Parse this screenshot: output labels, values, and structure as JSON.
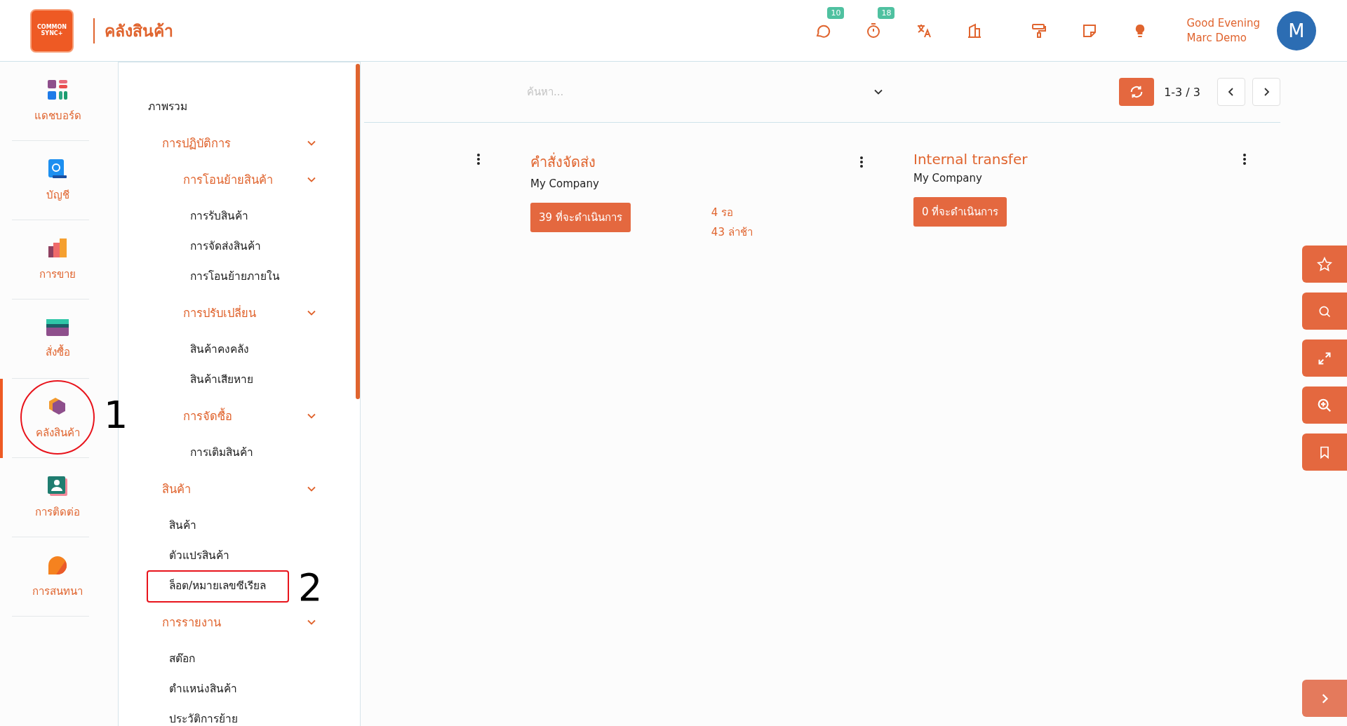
{
  "header": {
    "logo_text": [
      "COMMON",
      "SYNC+"
    ],
    "title": "คลังสินค้า",
    "icons": [
      {
        "kind": "chat",
        "badge": "10"
      },
      {
        "kind": "timer",
        "badge": "18"
      },
      {
        "kind": "translate"
      },
      {
        "kind": "building"
      },
      {
        "kind": "paint"
      },
      {
        "kind": "note"
      },
      {
        "kind": "bulb"
      }
    ],
    "greeting": "Good Evening",
    "user": "Marc Demo",
    "avatar": "M"
  },
  "sidebar": [
    {
      "label": "แดชบอร์ด",
      "selected": false
    },
    {
      "label": "บัญชี",
      "selected": false
    },
    {
      "label": "การขาย",
      "selected": false
    },
    {
      "label": "สั่งซื้อ",
      "selected": false
    },
    {
      "label": "คลังสินค้า",
      "selected": true,
      "callout": "1"
    },
    {
      "label": "การติดต่อ",
      "selected": false
    },
    {
      "label": "การสนทนา",
      "selected": false
    }
  ],
  "menu": [
    {
      "label": "ภาพรวม"
    },
    {
      "label": "การปฏิบัติการ",
      "expanded": true,
      "children": [
        {
          "label": "การโอนย้ายสินค้า",
          "expanded": true,
          "children": [
            {
              "label": "การรับสินค้า"
            },
            {
              "label": "การจัดส่งสินค้า"
            },
            {
              "label": "การโอนย้ายภายใน"
            }
          ]
        },
        {
          "label": "การปรับเปลี่ยน",
          "expanded": true,
          "children": [
            {
              "label": "สินค้าคงคลัง"
            },
            {
              "label": "สินค้าเสียหาย"
            }
          ]
        },
        {
          "label": "การจัดซื้อ",
          "expanded": true,
          "children": [
            {
              "label": "การเติมสินค้า"
            }
          ]
        }
      ]
    },
    {
      "label": "สินค้า",
      "expanded": true,
      "children": [
        {
          "label": "สินค้า"
        },
        {
          "label": "ตัวแปรสินค้า"
        },
        {
          "label": "ล็อต/หมายเลขซีเรียล",
          "callout": "2"
        }
      ]
    },
    {
      "label": "การรายงาน",
      "expanded": true,
      "children": [
        {
          "label": "สต๊อก"
        },
        {
          "label": "ตำแหน่งสินค้า"
        },
        {
          "label": "ประวัติการย้าย"
        }
      ]
    }
  ],
  "toolbar": {
    "search": {
      "placeholder": "ค้นหา..."
    },
    "pager": "1-3 / 3"
  },
  "cards": [
    {
      "title": "คำสั่งจัดส่ง",
      "company": "My Company",
      "action": "39 ที่จะดำเนินการ",
      "stats": [
        "4 รอ",
        "43 ล่าช้า"
      ]
    },
    {
      "title": "Internal transfer",
      "company": "My Company",
      "action": "0 ที่จะดำเนินการ"
    }
  ],
  "side_buttons": [
    {
      "kind": "star"
    },
    {
      "kind": "search"
    },
    {
      "kind": "expand"
    },
    {
      "kind": "zoom"
    },
    {
      "kind": "bookmark"
    }
  ]
}
